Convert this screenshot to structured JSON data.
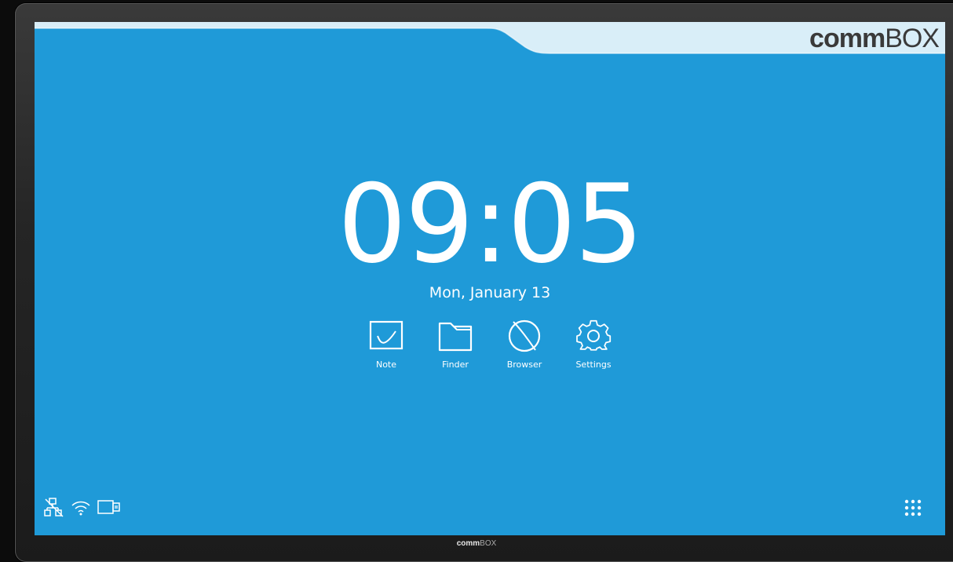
{
  "brand": {
    "logo_bold": "comm",
    "logo_light": "BOX",
    "bottom_bold": "comm",
    "bottom_light": "BOX"
  },
  "clock": {
    "hours": "09",
    "separator": ":",
    "minutes": "05",
    "date": "Mon, January 13"
  },
  "apps": [
    {
      "label": "Note",
      "icon": "note-icon"
    },
    {
      "label": "Finder",
      "icon": "folder-icon"
    },
    {
      "label": "Browser",
      "icon": "browser-icon"
    },
    {
      "label": "Settings",
      "icon": "gear-icon"
    }
  ],
  "status_icons": [
    "network-disconnected-icon",
    "wifi-icon",
    "usb-device-icon"
  ],
  "launcher_icon": "apps-grid-icon",
  "colors": {
    "screen_bg": "#1f9ad8",
    "top_band": "#d9eef8",
    "bezel": "#2a2a2a",
    "logo": "#3a3a3a"
  }
}
